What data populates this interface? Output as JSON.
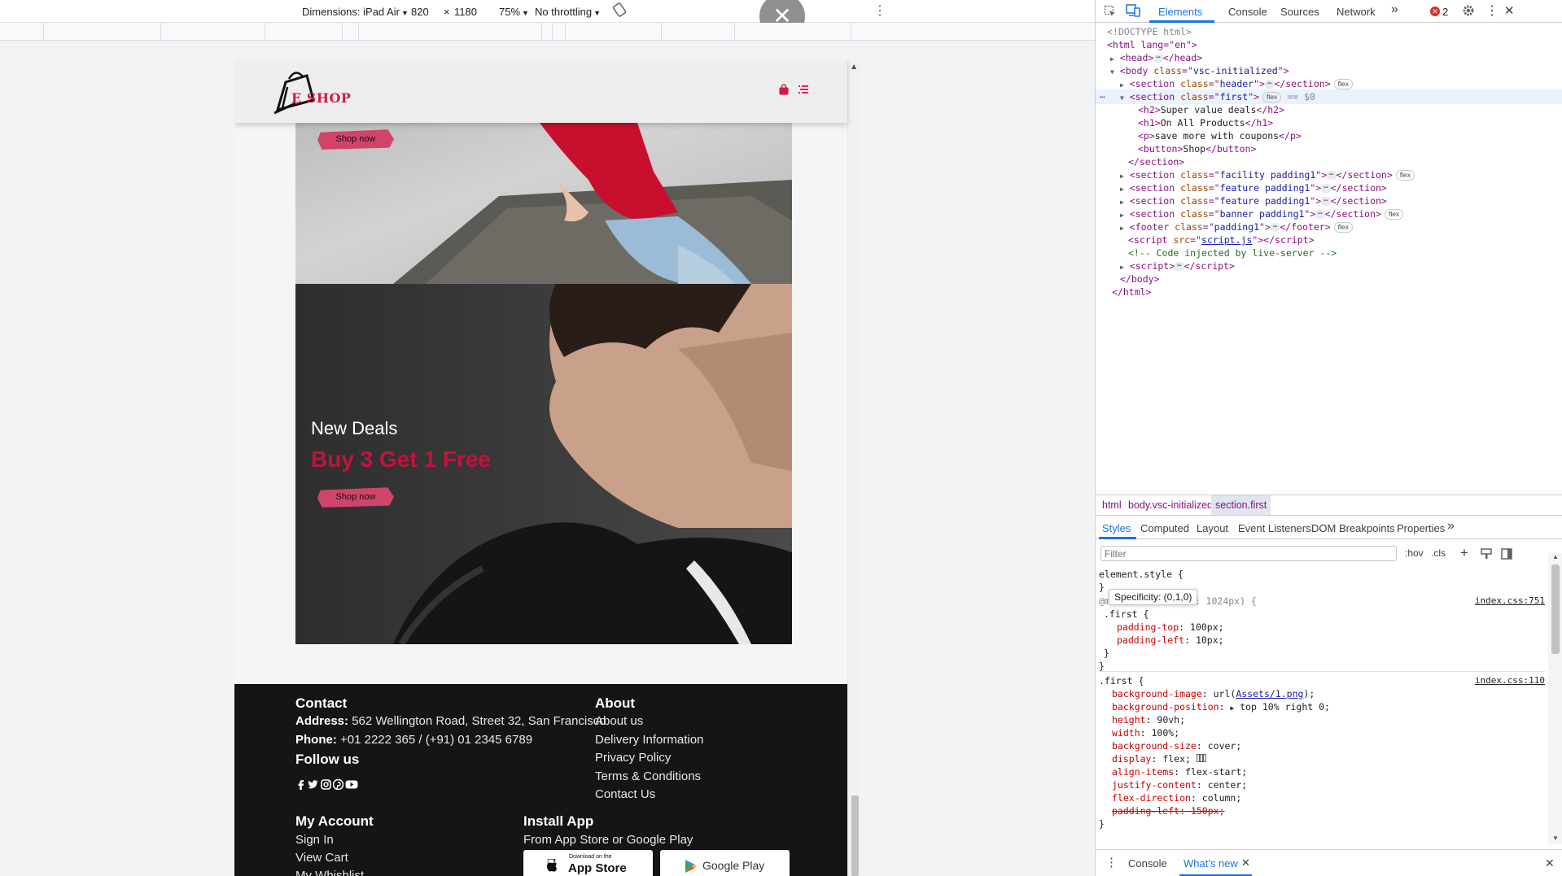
{
  "device_toolbar": {
    "dimensions_label": "Dimensions: iPad Air",
    "width": "820",
    "times": "×",
    "height": "1180",
    "zoom": "75%",
    "throttling": "No throttling",
    "close_glyph": "✕"
  },
  "site": {
    "logo_text": "E SHOP",
    "hero_button": "Shop now",
    "banner": {
      "subtitle": "New Deals",
      "title": "Buy 3 Get 1 Free",
      "button": "Shop now"
    },
    "footer": {
      "contact_heading": "Contact",
      "address_label": "Address:",
      "address_value": " 562 Wellington Road, Street 32, San Francisco",
      "phone_label": "Phone:",
      "phone_value": " +01 2222 365 / (+91) 01 2345 6789",
      "follow_heading": "Follow us",
      "about_heading": "About",
      "about_links": [
        "About us",
        "Delivery Information",
        "Privacy Policy",
        "Terms & Conditions",
        "Contact Us"
      ],
      "account_heading": "My Account",
      "account_links": [
        "Sign In",
        "View Cart",
        "My Whishlist"
      ],
      "install_heading": "Install App",
      "install_text": "From App Store or Google Play",
      "app_store_small": "Download on the",
      "app_store_big": "App Store",
      "google_play": "Google Play"
    },
    "colors": {
      "brand": "#d11a46",
      "footer_bg": "#151515",
      "button": "#d1446a"
    }
  },
  "devtools": {
    "tabs": [
      "Elements",
      "Console",
      "Sources",
      "Network"
    ],
    "more_tabs": "»",
    "error_count": "2",
    "dom": {
      "doctype": "<!DOCTYPE html>",
      "html_open": "<html lang=\"en\">",
      "head": "<head>",
      "head_close": "</head>",
      "body_open_tag": "body",
      "body_class": "vsc-initialized",
      "sec_header_class": "header",
      "sec_first_class": "first",
      "selected_marker": "== $0",
      "h2": "Super value deals",
      "h1": "On All Products",
      "p": "save more with coupons",
      "button": "Shop",
      "section_close": "</section>",
      "sec_facility_class": "facility padding1",
      "sec_feature_class": "feature padding1",
      "sec_banner_class": "banner padding1",
      "footer_class": "padding1",
      "script_src": "script.js",
      "comment": "<!-- Code injected by live-server -->",
      "body_close": "</body>",
      "html_close": "</html>",
      "flex_badge": "flex",
      "ellipsis": "⋯"
    },
    "breadcrumb": [
      "html",
      "body.vsc-initialized",
      "section.first"
    ],
    "sub_tabs": [
      "Styles",
      "Computed",
      "Layout",
      "Event Listeners",
      "DOM Breakpoints",
      "Properties"
    ],
    "filter_placeholder": "Filter",
    "filter_tools": [
      ":hov",
      ".cls"
    ],
    "tooltip": "Specificity: (0,1,0)",
    "styles": {
      "element_style": "element.style {",
      "close_brace": "}",
      "media_query": "@media (max-width: 1024px) {",
      "media_source": "index.css:751",
      "first_selector": ".first {",
      "media_props": [
        {
          "name": "padding-top",
          "value": "100px;"
        },
        {
          "name": "padding-left",
          "value": "10px;"
        }
      ],
      "rule_source": "index.css:110",
      "rule_props": [
        {
          "name": "background-image",
          "value": "url(Assets/1.png);"
        },
        {
          "name": "background-position",
          "value": "top 10% right 0;"
        },
        {
          "name": "height",
          "value": "90vh;"
        },
        {
          "name": "width",
          "value": "100%;"
        },
        {
          "name": "background-size",
          "value": "cover;"
        },
        {
          "name": "display",
          "value": "flex;"
        },
        {
          "name": "align-items",
          "value": "flex-start;"
        },
        {
          "name": "justify-content",
          "value": "center;"
        },
        {
          "name": "flex-direction",
          "value": "column;"
        }
      ],
      "overridden": {
        "name": "padding-left",
        "value": "150px;"
      },
      "bg_url": "Assets/1.png"
    },
    "drawer_tabs": [
      "Console",
      "What's new"
    ]
  }
}
